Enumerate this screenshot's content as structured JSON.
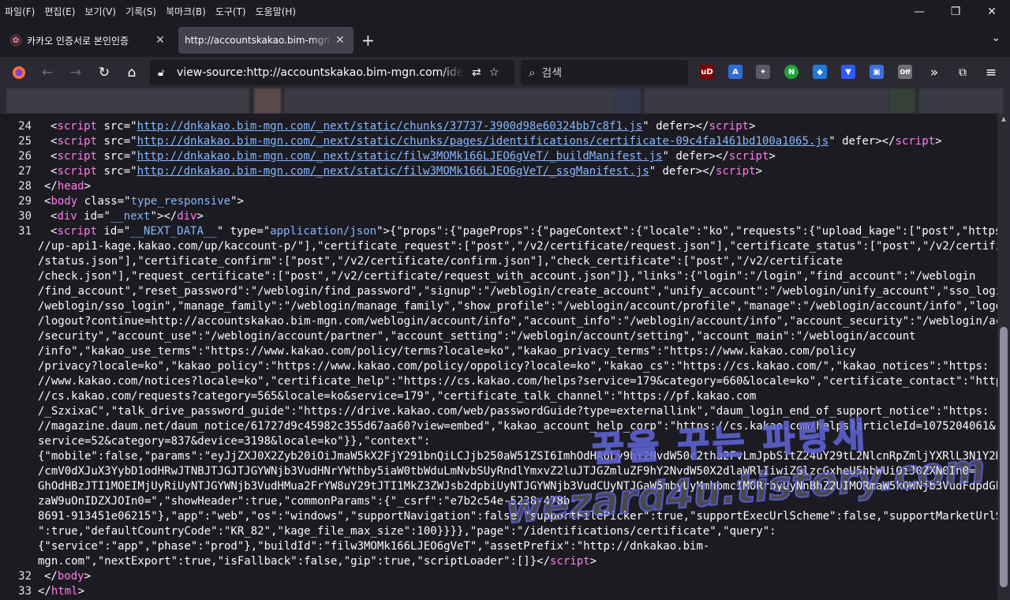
{
  "menubar": {
    "items": [
      "파일(F)",
      "편집(E)",
      "보기(V)",
      "기록(S)",
      "북마크(B)",
      "도구(T)",
      "도움말(H)"
    ],
    "minimize": "—",
    "restore": "❐",
    "close": "✕"
  },
  "tabs": {
    "items": [
      {
        "title": "카카오 인증서로 본인인증",
        "close": "✕"
      },
      {
        "title": "http://accountskakao.bim-mgn.com/identifications/certificate",
        "close": "✕"
      }
    ],
    "new_tab": "+",
    "list_all": "⌄"
  },
  "navbar": {
    "back": "←",
    "forward": "→",
    "reload": "↻",
    "home": "⌂",
    "url": "view-source:http://accountskakao.bim-mgn.com/identifications/certificate",
    "search_placeholder": "검색",
    "overflow": "»",
    "menu": "≡"
  },
  "extensions": [
    {
      "name": "ublock",
      "label": "uD",
      "color": "#800000"
    },
    {
      "name": "translate",
      "label": "A",
      "color": "#2e6bd9"
    },
    {
      "name": "puzzle",
      "label": "✦",
      "color": "#5b5b66"
    },
    {
      "name": "n-ext",
      "label": "N",
      "color": "#1fa33a"
    },
    {
      "name": "shield",
      "label": "◆",
      "color": "#1f7bd8"
    },
    {
      "name": "arrow-ext",
      "label": "▼",
      "color": "#2d5bff"
    },
    {
      "name": "box-ext",
      "label": "▣",
      "color": "#3b6fd6"
    },
    {
      "name": "off-ext",
      "label": "Off",
      "color": "#6f6e75"
    }
  ],
  "source": {
    "lines": [
      {
        "n": "24",
        "parts": [
          [
            "t",
            "<"
          ],
          [
            "tag",
            "script"
          ],
          [
            "t",
            " "
          ],
          [
            "a",
            "src"
          ],
          [
            "t",
            "=\""
          ],
          [
            "l",
            "http://dnkakao.bim-mgn.com/_next/static/chunks/37737-3900d98e60324bb7c8f1.js"
          ],
          [
            "t",
            "\" "
          ],
          [
            "a",
            "defer"
          ],
          [
            "t",
            "></"
          ],
          [
            "tag",
            "script"
          ],
          [
            "t",
            ">"
          ]
        ],
        "indent": 2
      },
      {
        "n": "25",
        "parts": [
          [
            "t",
            "<"
          ],
          [
            "tag",
            "script"
          ],
          [
            "t",
            " "
          ],
          [
            "a",
            "src"
          ],
          [
            "t",
            "=\""
          ],
          [
            "l",
            "http://dnkakao.bim-mgn.com/_next/static/chunks/pages/identifications/certificate-09c4fa1461bd100a1065.js"
          ],
          [
            "t",
            "\" "
          ],
          [
            "a",
            "defer"
          ],
          [
            "t",
            "></"
          ],
          [
            "tag",
            "script"
          ],
          [
            "t",
            ">"
          ]
        ],
        "indent": 2
      },
      {
        "n": "26",
        "parts": [
          [
            "t",
            "<"
          ],
          [
            "tag",
            "script"
          ],
          [
            "t",
            " "
          ],
          [
            "a",
            "src"
          ],
          [
            "t",
            "=\""
          ],
          [
            "l",
            "http://dnkakao.bim-mgn.com/_next/static/filw3MOMk166LJEO6gVeT/_buildManifest.js"
          ],
          [
            "t",
            "\" "
          ],
          [
            "a",
            "defer"
          ],
          [
            "t",
            "></"
          ],
          [
            "tag",
            "script"
          ],
          [
            "t",
            ">"
          ]
        ],
        "indent": 2
      },
      {
        "n": "27",
        "parts": [
          [
            "t",
            "<"
          ],
          [
            "tag",
            "script"
          ],
          [
            "t",
            " "
          ],
          [
            "a",
            "src"
          ],
          [
            "t",
            "=\""
          ],
          [
            "l",
            "http://dnkakao.bim-mgn.com/_next/static/filw3MOMk166LJEO6gVeT/_ssgManifest.js"
          ],
          [
            "t",
            "\" "
          ],
          [
            "a",
            "defer"
          ],
          [
            "t",
            "></"
          ],
          [
            "tag",
            "script"
          ],
          [
            "t",
            ">"
          ]
        ],
        "indent": 2
      },
      {
        "n": "28",
        "parts": [
          [
            "t",
            "</"
          ],
          [
            "tag",
            "head"
          ],
          [
            "t",
            ">"
          ]
        ],
        "indent": 1
      },
      {
        "n": "29",
        "parts": [
          [
            "t",
            "<"
          ],
          [
            "tag",
            "body"
          ],
          [
            "t",
            " "
          ],
          [
            "a",
            "class"
          ],
          [
            "t",
            "=\""
          ],
          [
            "v",
            "type_responsive"
          ],
          [
            "t",
            "\">"
          ]
        ],
        "indent": 1
      },
      {
        "n": "30",
        "parts": [
          [
            "t",
            "<"
          ],
          [
            "tag",
            "div"
          ],
          [
            "t",
            " "
          ],
          [
            "a",
            "id"
          ],
          [
            "t",
            "=\""
          ],
          [
            "v",
            "__next"
          ],
          [
            "t",
            "\"></"
          ],
          [
            "tag",
            "div"
          ],
          [
            "t",
            ">"
          ]
        ],
        "indent": 2
      },
      {
        "n": "31",
        "parts": [
          [
            "t",
            "<"
          ],
          [
            "tag",
            "script"
          ],
          [
            "t",
            " "
          ],
          [
            "a",
            "id"
          ],
          [
            "t",
            "=\""
          ],
          [
            "v",
            "__NEXT_DATA__"
          ],
          [
            "t",
            "\" "
          ],
          [
            "a",
            "type"
          ],
          [
            "t",
            "=\""
          ],
          [
            "v",
            "application/json"
          ],
          [
            "t",
            "\">{\"props\":{\"pageProps\":{\"pageContext\":{\"locale\":\"ko\",\"requests\":{\"upload_kage\":[\"post\",\"https:"
          ]
        ],
        "indent": 2
      },
      {
        "n": "",
        "parts": [
          [
            "t",
            "//up-api1-kage.kakao.com/up/kaccount-p/\"],\"certificate_request\":[\"post\",\"/v2/certificate/request.json\"],\"certificate_status\":[\"post\",\"/v2/certificate"
          ]
        ],
        "indent": 0
      },
      {
        "n": "",
        "parts": [
          [
            "t",
            "/status.json\"],\"certificate_confirm\":[\"post\",\"/v2/certificate/confirm.json\"],\"check_certificate\":[\"post\",\"/v2/certificate"
          ]
        ],
        "indent": 0
      },
      {
        "n": "",
        "parts": [
          [
            "t",
            "/check.json\"],\"request_certificate\":[\"post\",\"/v2/certificate/request_with_account.json\"]},\"links\":{\"login\":\"/login\",\"find_account\":\"/weblogin"
          ]
        ],
        "indent": 0
      },
      {
        "n": "",
        "parts": [
          [
            "t",
            "/find_account\",\"reset_password\":\"/weblogin/find_password\",\"signup\":\"/weblogin/create_account\",\"unify_account\":\"/weblogin/unify_account\",\"sso_login\":\""
          ]
        ],
        "indent": 0
      },
      {
        "n": "",
        "parts": [
          [
            "t",
            "/weblogin/sso_login\",\"manage_family\":\"/weblogin/manage_family\",\"show_profile\":\"/weblogin/account/profile\",\"manage\":\"/weblogin/account/info\",\"logout\":\""
          ]
        ],
        "indent": 0
      },
      {
        "n": "",
        "parts": [
          [
            "t",
            "/logout?continue=http://accountskakao.bim-mgn.com/weblogin/account/info\",\"account_info\":\"/weblogin/account/info\",\"account_security\":\"/weblogin/account"
          ]
        ],
        "indent": 0
      },
      {
        "n": "",
        "parts": [
          [
            "t",
            "/security\",\"account_use\":\"/weblogin/account/partner\",\"account_setting\":\"/weblogin/account/setting\",\"account_main\":\"/weblogin/account"
          ]
        ],
        "indent": 0
      },
      {
        "n": "",
        "parts": [
          [
            "t",
            "/info\",\"kakao_use_terms\":\"https://www.kakao.com/policy/terms?locale=ko\",\"kakao_privacy_terms\":\"https://www.kakao.com/policy"
          ]
        ],
        "indent": 0
      },
      {
        "n": "",
        "parts": [
          [
            "t",
            "/privacy?locale=ko\",\"kakao_policy\":\"https://www.kakao.com/policy/oppolicy?locale=ko\",\"kakao_cs\":\"https://cs.kakao.com/\",\"kakao_notices\":\"https:"
          ]
        ],
        "indent": 0
      },
      {
        "n": "",
        "parts": [
          [
            "t",
            "//www.kakao.com/notices?locale=ko\",\"certificate_help\":\"https://cs.kakao.com/helps?service=179&category=660&locale=ko\",\"certificate_contact\":\"https:"
          ]
        ],
        "indent": 0
      },
      {
        "n": "",
        "parts": [
          [
            "t",
            "//cs.kakao.com/requests?category=565&locale=ko&service=179\",\"certificate_talk_channel\":\"https://pf.kakao.com"
          ]
        ],
        "indent": 0
      },
      {
        "n": "",
        "parts": [
          [
            "t",
            "/_SzxixaC\",\"talk_drive_password_guide\":\"https://drive.kakao.com/web/passwordGuide?type=externallink\",\"daum_login_end_of_support_notice\":\"https:"
          ]
        ],
        "indent": 0
      },
      {
        "n": "",
        "parts": [
          [
            "t",
            "//magazine.daum.net/daum_notice/61727d9c45982c355d67aa60?view=embed\",\"kakao_account_help_corp\":\"https://cs.kakao.com/helps?articleId=1075204061&"
          ]
        ],
        "indent": 0
      },
      {
        "n": "",
        "parts": [
          [
            "t",
            "service=52&category=837&device=3198&locale=ko\"}},\"context\":"
          ]
        ],
        "indent": 0
      },
      {
        "n": "",
        "parts": [
          [
            "t",
            "{\"mobile\":false,\"params\":\"eyJjZXJ0X2Zyb20iOiJmaW5kX2FjY291bnQiLCJjb250aW51ZSI6ImhOdHA6Ly9hY2NvdW50c2tha2FvLmJpbS1tZ24uY29tL2NlcnRpZmljYXRlL3N1Y2Nlc3M"
          ]
        ],
        "indent": 0
      },
      {
        "n": "",
        "parts": [
          [
            "t",
            "/cmV0dXJuX3YybD1odHRwJTNBJTJGJTJGYWNjb3VudHNrYWthby5iaW0tbWduLmNvbSUyRndlYmxvZ2luJTJGZmluZF9hY2NvdW50X2dlaWRlIiwiZGlzcGxheU5hbWUiOiJ0ZXN0In0="
          ]
        ],
        "indent": 0
      },
      {
        "n": "",
        "parts": [
          [
            "t",
            "GhOdHBzJTI1MOEIMjUyRiUyNTJGYWNjb3VudHMua2FrYW8uY29tJTI1MkZ3ZWJsb2dpbiUyNTJGYWNjb3VudCUyNTJGaW5mbyUyMmhbmcIMORrbyUyNnBhZ2UIMORmaW5kQWNjb3VudFdpdGhTZXN"
          ]
        ],
        "indent": 0
      },
      {
        "n": "",
        "parts": [
          [
            "t",
            "zaW9uOnIDZXJOIn0=\",\"showHeader\":true,\"commonParams\":{\"_csrf\":\"e7b2c54e-5238-478b-"
          ]
        ],
        "indent": 0
      },
      {
        "n": "",
        "parts": [
          [
            "t",
            "8691-913451e06215\"},\"app\":\"web\",\"os\":\"windows\",\"supportNavigation\":false,\"supportFilePicker\":true,\"supportExecUrlScheme\":false,\"supportMarketUrlScheme"
          ]
        ],
        "indent": 0
      },
      {
        "n": "",
        "parts": [
          [
            "t",
            "\":true,\"defaultCountryCode\":\"KR_82\",\"kage_file_max_size\":100}}}},\"page\":\"/identifications/certificate\",\"query\":"
          ]
        ],
        "indent": 0
      },
      {
        "n": "",
        "parts": [
          [
            "t",
            "{\"service\":\"app\",\"phase\":\"prod\"},\"buildId\":\"filw3MOMk166LJEO6gVeT\",\"assetPrefix\":\"http://dnkakao.bim-"
          ]
        ],
        "indent": 0
      },
      {
        "n": "",
        "parts": [
          [
            "t",
            "mgn.com\",\"nextExport\":true,\"isFallback\":false,\"gip\":true,\"scriptLoader\":[]}</"
          ],
          [
            "tag",
            "script"
          ],
          [
            "t",
            ">"
          ]
        ],
        "indent": 0
      },
      {
        "n": "32",
        "parts": [
          [
            "t",
            "</"
          ],
          [
            "tag",
            "body"
          ],
          [
            "t",
            ">"
          ]
        ],
        "indent": 1
      },
      {
        "n": "33",
        "parts": [
          [
            "t",
            "</"
          ],
          [
            "tag",
            "html"
          ],
          [
            "t",
            ">"
          ]
        ],
        "indent": 0
      }
    ]
  },
  "watermark": {
    "line1": "꿈을 꾸는 파랑새",
    "line2": "wezard4u.tistory.com"
  },
  "colors": {
    "tag": "#ff7de9",
    "link": "#86b8ff",
    "background": "#1c1b22",
    "toolbar": "#2b2a33"
  }
}
